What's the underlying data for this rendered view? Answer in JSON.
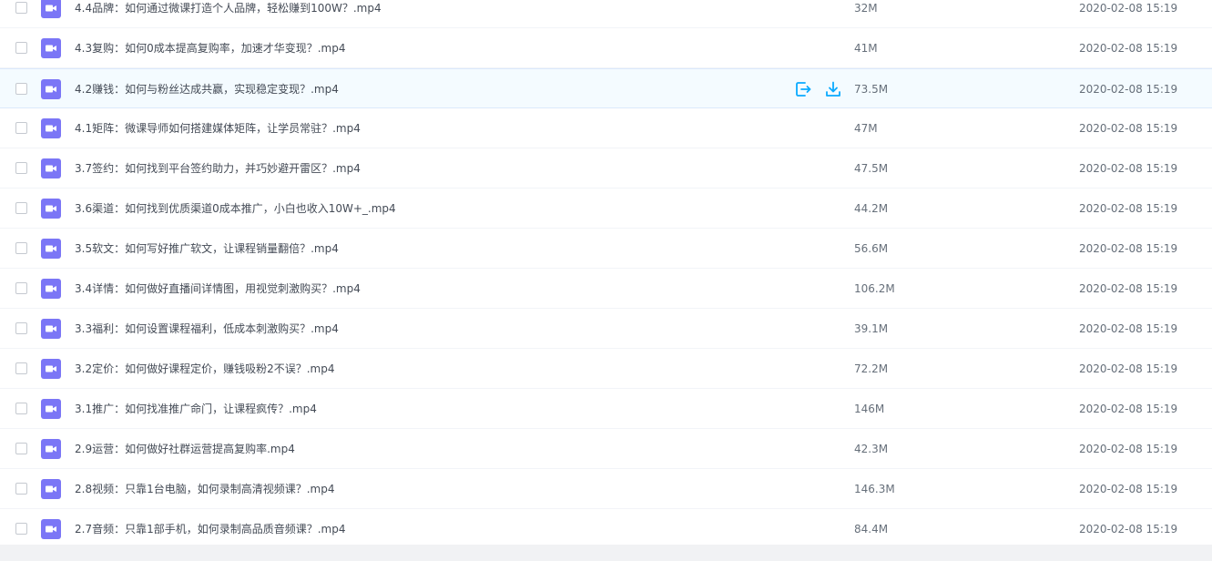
{
  "icons": {
    "video": "video-camera-icon",
    "share": "share-export-icon",
    "download": "download-icon"
  },
  "colors": {
    "video_icon_bg": "#7b76f6",
    "action_blue": "#09aaff",
    "hover_row_bg": "#f4fbff"
  },
  "files": [
    {
      "name": "4.4品牌：如何通过微课打造个人品牌，轻松赚到100W？.mp4",
      "size": "32M",
      "date": "2020-02-08 15:19"
    },
    {
      "name": "4.3复购：如何0成本提高复购率，加速才华变现？.mp4",
      "size": "41M",
      "date": "2020-02-08 15:19"
    },
    {
      "name": "4.2赚钱：如何与粉丝达成共赢，实现稳定变现？.mp4",
      "size": "73.5M",
      "date": "2020-02-08 15:19"
    },
    {
      "name": "4.1矩阵：微课导师如何搭建媒体矩阵，让学员常驻？.mp4",
      "size": "47M",
      "date": "2020-02-08 15:19"
    },
    {
      "name": "3.7签约：如何找到平台签约助力，并巧妙避开雷区？.mp4",
      "size": "47.5M",
      "date": "2020-02-08 15:19"
    },
    {
      "name": "3.6渠道：如何找到优质渠道0成本推广，小白也收入10W+_.mp4",
      "size": "44.2M",
      "date": "2020-02-08 15:19"
    },
    {
      "name": "3.5软文：如何写好推广软文，让课程销量翻倍？.mp4",
      "size": "56.6M",
      "date": "2020-02-08 15:19"
    },
    {
      "name": "3.4详情：如何做好直播间详情图，用视觉刺激购买？.mp4",
      "size": "106.2M",
      "date": "2020-02-08 15:19"
    },
    {
      "name": "3.3福利：如何设置课程福利，低成本刺激购买？.mp4",
      "size": "39.1M",
      "date": "2020-02-08 15:19"
    },
    {
      "name": "3.2定价：如何做好课程定价，赚钱吸粉2不误？.mp4",
      "size": "72.2M",
      "date": "2020-02-08 15:19"
    },
    {
      "name": "3.1推广：如何找准推广命门，让课程疯传？.mp4",
      "size": "146M",
      "date": "2020-02-08 15:19"
    },
    {
      "name": "2.9运营：如何做好社群运营提高复购率.mp4",
      "size": "42.3M",
      "date": "2020-02-08 15:19"
    },
    {
      "name": "2.8视频：只靠1台电脑，如何录制高清视频课？.mp4",
      "size": "146.3M",
      "date": "2020-02-08 15:19"
    },
    {
      "name": "2.7音频：只靠1部手机，如何录制高品质音频课？.mp4",
      "size": "84.4M",
      "date": "2020-02-08 15:19"
    }
  ]
}
